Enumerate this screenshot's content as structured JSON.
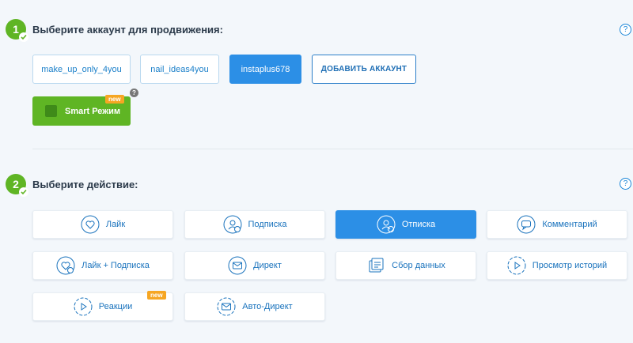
{
  "step1": {
    "number": "1",
    "title": "Выберите аккаунт для продвижения:"
  },
  "accounts": [
    "make_up_only_4you",
    "nail_ideas4you",
    "instaplus678"
  ],
  "add_account_label": "ДОБАВИТЬ АККАУНТ",
  "smart_mode": {
    "label": "Smart Режим",
    "badge": "new"
  },
  "step2": {
    "number": "2",
    "title": "Выберите действие:"
  },
  "help_glyph": "?",
  "actions": {
    "like": "Лайк",
    "follow": "Подписка",
    "unfollow": "Отписка",
    "comment": "Комментарий",
    "like_follow": "Лайк + Подписка",
    "direct": "Директ",
    "data_collection": "Сбор данных",
    "story_view": "Просмотр историй",
    "reactions": "Реакции",
    "reactions_badge": "new",
    "auto_direct": "Авто-Директ"
  },
  "colors": {
    "green": "#5fb524",
    "blue": "#2c8fe6",
    "orange": "#f6a623"
  }
}
